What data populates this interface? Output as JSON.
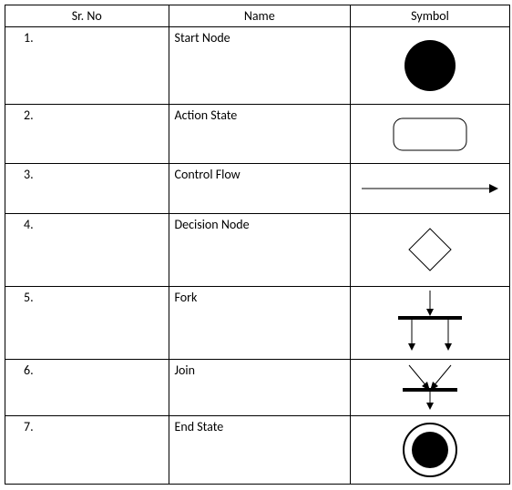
{
  "headers": {
    "sr": "Sr. No",
    "name": "Name",
    "symbol": "Symbol"
  },
  "rows": [
    {
      "sr": "1.",
      "name": "Start Node",
      "symbol": "start-node"
    },
    {
      "sr": "2.",
      "name": "Action State",
      "symbol": "action-state"
    },
    {
      "sr": "3.",
      "name": "Control Flow",
      "symbol": "control-flow"
    },
    {
      "sr": "4.",
      "name": "Decision Node",
      "symbol": "decision-node"
    },
    {
      "sr": "5.",
      "name": "Fork",
      "symbol": "fork"
    },
    {
      "sr": "6.",
      "name": "Join",
      "symbol": "join"
    },
    {
      "sr": "7.",
      "name": "End State",
      "symbol": "end-state"
    }
  ]
}
